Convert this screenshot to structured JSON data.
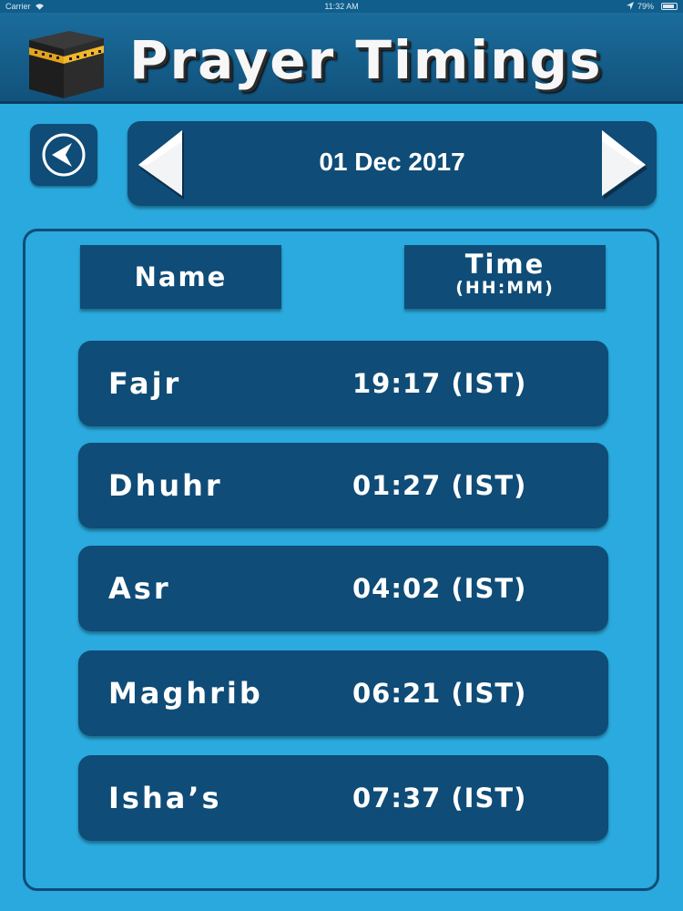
{
  "status_bar": {
    "carrier": "Carrier",
    "time": "11:32 AM",
    "battery": "79%"
  },
  "header": {
    "title": "Prayer Timings",
    "logo_icon": "kaaba-icon"
  },
  "navigation": {
    "back_icon": "back-arrow-icon",
    "prev_icon": "previous-date-arrow-icon",
    "next_icon": "next-date-arrow-icon",
    "date": "01 Dec 2017"
  },
  "table": {
    "headers": {
      "name": "Name",
      "time": "Time",
      "time_format": "(HH:MM)"
    },
    "rows": [
      {
        "name": "Fajr",
        "time": "19:17 (IST)"
      },
      {
        "name": "Dhuhr",
        "time": "01:27 (IST)"
      },
      {
        "name": "Asr",
        "time": "04:02 (IST)"
      },
      {
        "name": "Maghrib",
        "time": "06:21 (IST)"
      },
      {
        "name": "Isha’s",
        "time": "07:37 (IST)"
      }
    ]
  },
  "colors": {
    "background": "#29a9dd",
    "panel": "#0f4c77",
    "header": "#11527c",
    "text": "#ffffff"
  }
}
